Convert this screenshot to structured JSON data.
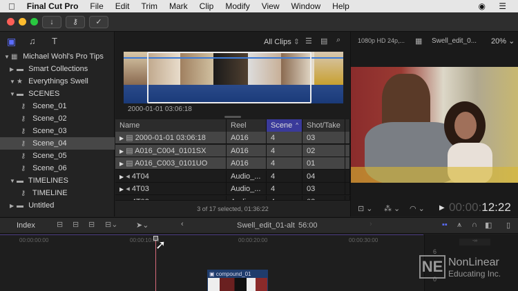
{
  "menubar": {
    "apple": "",
    "app": "Final Cut Pro",
    "items": [
      "File",
      "Edit",
      "Trim",
      "Mark",
      "Clip",
      "Modify",
      "View",
      "Window",
      "Help"
    ]
  },
  "sidebar": {
    "items": [
      {
        "label": "Michael Wohl's Pro Tips",
        "level": 0,
        "tri": "▼",
        "icon": "library-icon"
      },
      {
        "label": "Smart Collections",
        "level": 1,
        "tri": "▶",
        "icon": "folder-icon"
      },
      {
        "label": "Everythings Swell",
        "level": 1,
        "tri": "▼",
        "icon": "event-icon"
      },
      {
        "label": "SCENES",
        "level": 2,
        "tri": "▼",
        "icon": "folder-icon"
      },
      {
        "label": "Scene_01",
        "level": 3,
        "tri": "",
        "icon": "keyword-icon"
      },
      {
        "label": "Scene_02",
        "level": 3,
        "tri": "",
        "icon": "keyword-icon"
      },
      {
        "label": "Scene_03",
        "level": 3,
        "tri": "",
        "icon": "keyword-icon"
      },
      {
        "label": "Scene_04",
        "level": 3,
        "tri": "",
        "icon": "keyword-icon",
        "selected": true
      },
      {
        "label": "Scene_05",
        "level": 3,
        "tri": "",
        "icon": "keyword-icon"
      },
      {
        "label": "Scene_06",
        "level": 3,
        "tri": "",
        "icon": "keyword-icon"
      },
      {
        "label": "TIMELINES",
        "level": 2,
        "tri": "▼",
        "icon": "folder-icon"
      },
      {
        "label": "TIMELINE",
        "level": 3,
        "tri": "",
        "icon": "keyword-icon"
      },
      {
        "label": "Untitled",
        "level": 2,
        "tri": "▶",
        "icon": "folder-icon"
      }
    ]
  },
  "browser": {
    "filter": "All Clips",
    "filmstrip_label": "2000-01-01 03:06:18",
    "status": "3 of 17 selected, 01:36:22",
    "columns": [
      "Name",
      "Reel",
      "Scene",
      "Shot/Take",
      "D"
    ],
    "rows": [
      {
        "name": "2000-01-01 03:06:18",
        "reel": "A016",
        "scene": "4",
        "shot": "03",
        "type": "video",
        "selected": true
      },
      {
        "name": "A016_C004_0101SX",
        "reel": "A016",
        "scene": "4",
        "shot": "02",
        "type": "video",
        "selected": true
      },
      {
        "name": "A016_C003_0101UO",
        "reel": "A016",
        "scene": "4",
        "shot": "01",
        "type": "video",
        "selected": true
      },
      {
        "name": "4T04",
        "reel": "Audio_...",
        "scene": "4",
        "shot": "04",
        "type": "audio"
      },
      {
        "name": "4T03",
        "reel": "Audio_...",
        "scene": "4",
        "shot": "03",
        "type": "audio"
      },
      {
        "name": "4T02",
        "reel": "Audio_...",
        "scene": "4",
        "shot": "02",
        "type": "audio"
      }
    ]
  },
  "viewer": {
    "format": "1080p HD 24p,...",
    "project": "Swell_edit_0...",
    "zoom": "20%",
    "timecode_dim": "00:00:",
    "timecode": "12:22"
  },
  "timeline": {
    "index": "Index",
    "project": "Swell_edit_01-alt",
    "duration": "56:00",
    "ticks": [
      "00:00:00:00",
      "00:00:10:00",
      "00:00:20:00",
      "00:00:30:00"
    ],
    "clip": "compound_01",
    "meter_labels": [
      "6",
      "0",
      "-∞"
    ]
  },
  "watermark": {
    "line1": "NonLinear",
    "line2": "Educating Inc.",
    "logo": "NE"
  },
  "colors": {
    "accent": "#4a4ab8",
    "playhead": "#d96a7a",
    "filmstrip_selection": "#ffffff"
  }
}
